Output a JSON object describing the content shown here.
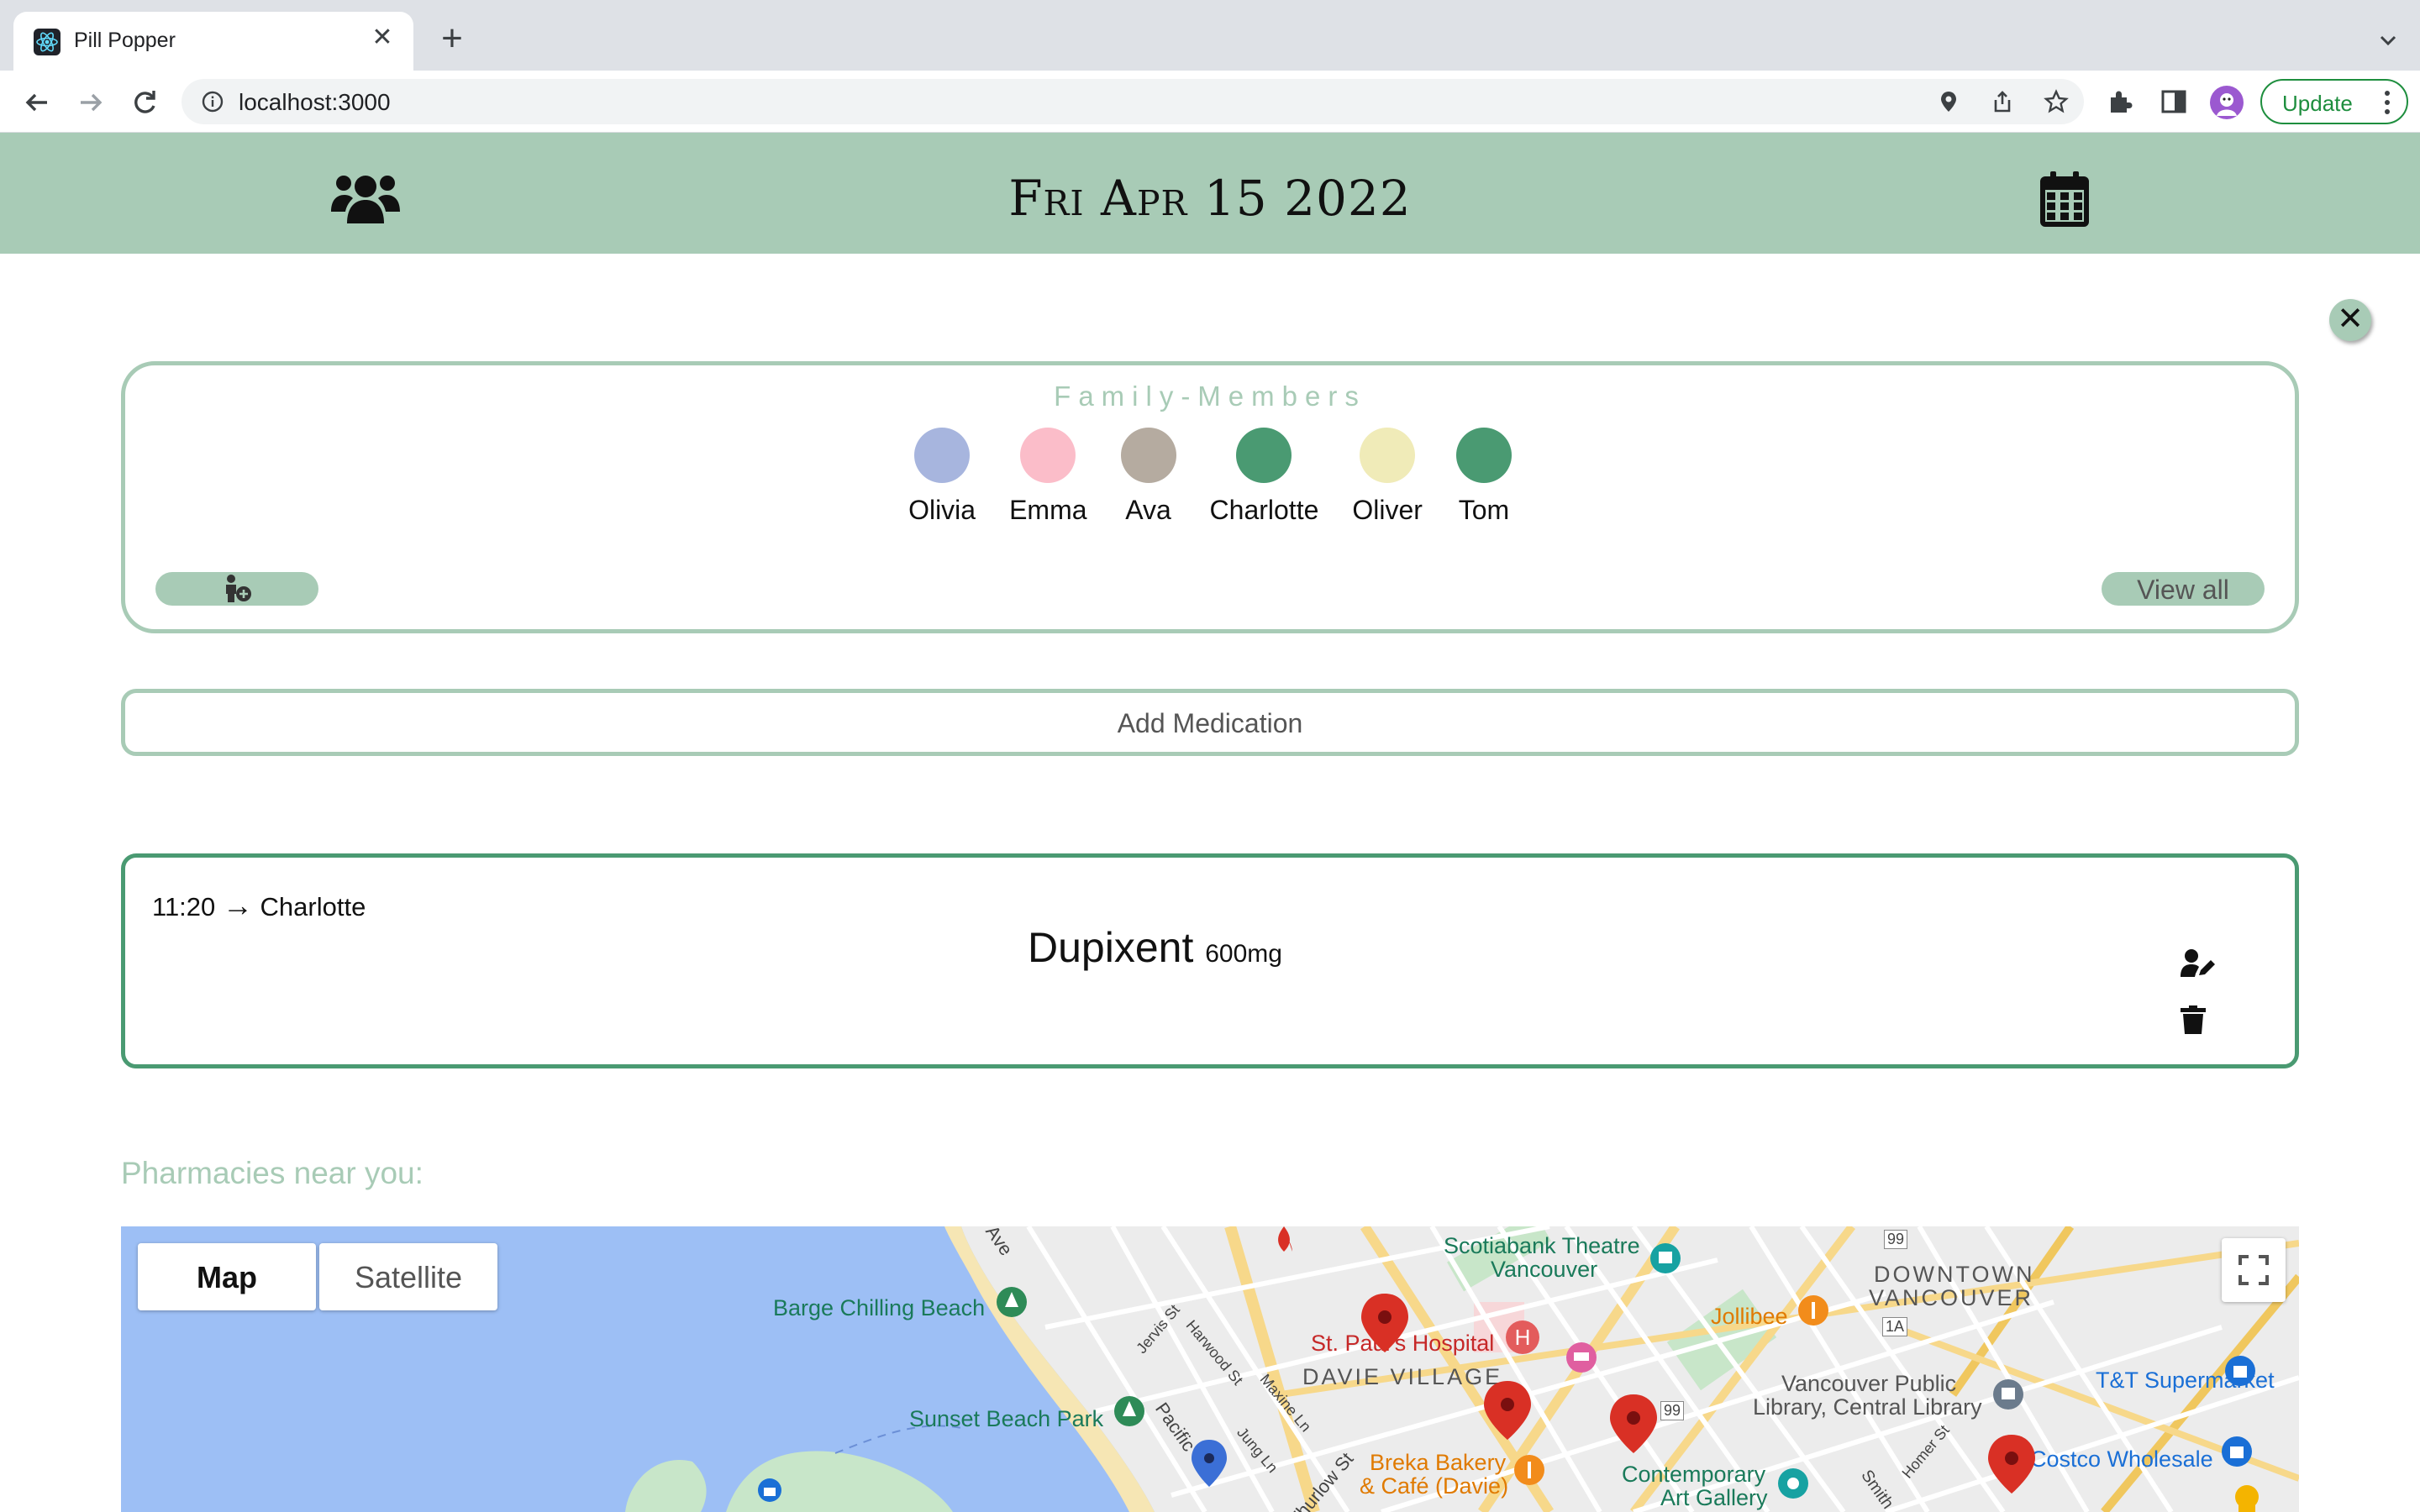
{
  "browser": {
    "tab_title": "Pill Popper",
    "tab_close_glyph": "✕",
    "new_tab_glyph": "+",
    "url": "localhost:3000",
    "update_label": "Update",
    "icons": [
      "back-icon",
      "forward-icon",
      "reload-icon",
      "site-info-icon",
      "location-icon",
      "share-icon",
      "bookmark-star-icon",
      "extensions-icon",
      "side-panel-icon",
      "profile-avatar",
      "kebab-menu-icon",
      "tab-list-chevron-icon"
    ]
  },
  "header": {
    "date": "Fri Apr 15 2022",
    "left_icon": "users-icon",
    "right_icon": "calendar-icon",
    "background": "#a8cbb6"
  },
  "close_glyph": "✕",
  "family": {
    "title": "Family-Members",
    "members": [
      {
        "name": "Olivia",
        "color": "#a7b5de"
      },
      {
        "name": "Emma",
        "color": "#fbbdc9"
      },
      {
        "name": "Ava",
        "color": "#b5aba0"
      },
      {
        "name": "Charlotte",
        "color": "#4a9a72"
      },
      {
        "name": "Oliver",
        "color": "#f0ebb8"
      },
      {
        "name": "Tom",
        "color": "#4a9a72"
      }
    ],
    "add_member_icon": "add-person-icon",
    "view_all_label": "View all"
  },
  "add_medication_label": "Add Medication",
  "medication": {
    "time": "11:20",
    "arrow": "→",
    "member": "Charlotte",
    "name": "Dupixent",
    "dose": "600mg",
    "edit_icon": "user-edit-icon",
    "delete_icon": "trash-icon"
  },
  "pharmacies_title": "Pharmacies near you:",
  "map": {
    "map_button": "Map",
    "satellite_button": "Satellite",
    "labels": {
      "scotiabank": "Scotiabank Theatre",
      "scotiabank2": "Vancouver",
      "downtown": "DOWNTOWN",
      "downtown2": "VANCOUVER",
      "barge": "Barge Chilling Beach",
      "st_pauls": "St. Paul's Hospital",
      "jollibee": "Jollibee",
      "davie": "DAVIE VILLAGE",
      "library": "Vancouver Public",
      "library2": "Library, Central Library",
      "tt": "T&T Supermarket",
      "sunset": "Sunset Beach Park",
      "breka": "Breka Bakery",
      "breka2": "& Café (Davie)",
      "contemporary": "Contemporary",
      "contemporary2": "Art Gallery",
      "costco": "Costco Wholesale",
      "thurlow": "Thurlow St",
      "pacific": "Pacific",
      "ave": "Ave",
      "jervis": "Jervis St",
      "harwood": "Harwood St",
      "maxine": "Maxine Ln",
      "jung": "Jung Ln",
      "homer": "Homer St",
      "smith": "Smith",
      "hwy99": "99",
      "hwy1a": "1A"
    },
    "pin_color": "#d93025",
    "water_color": "#9dbff5",
    "park_color": "#c8e6c9"
  }
}
